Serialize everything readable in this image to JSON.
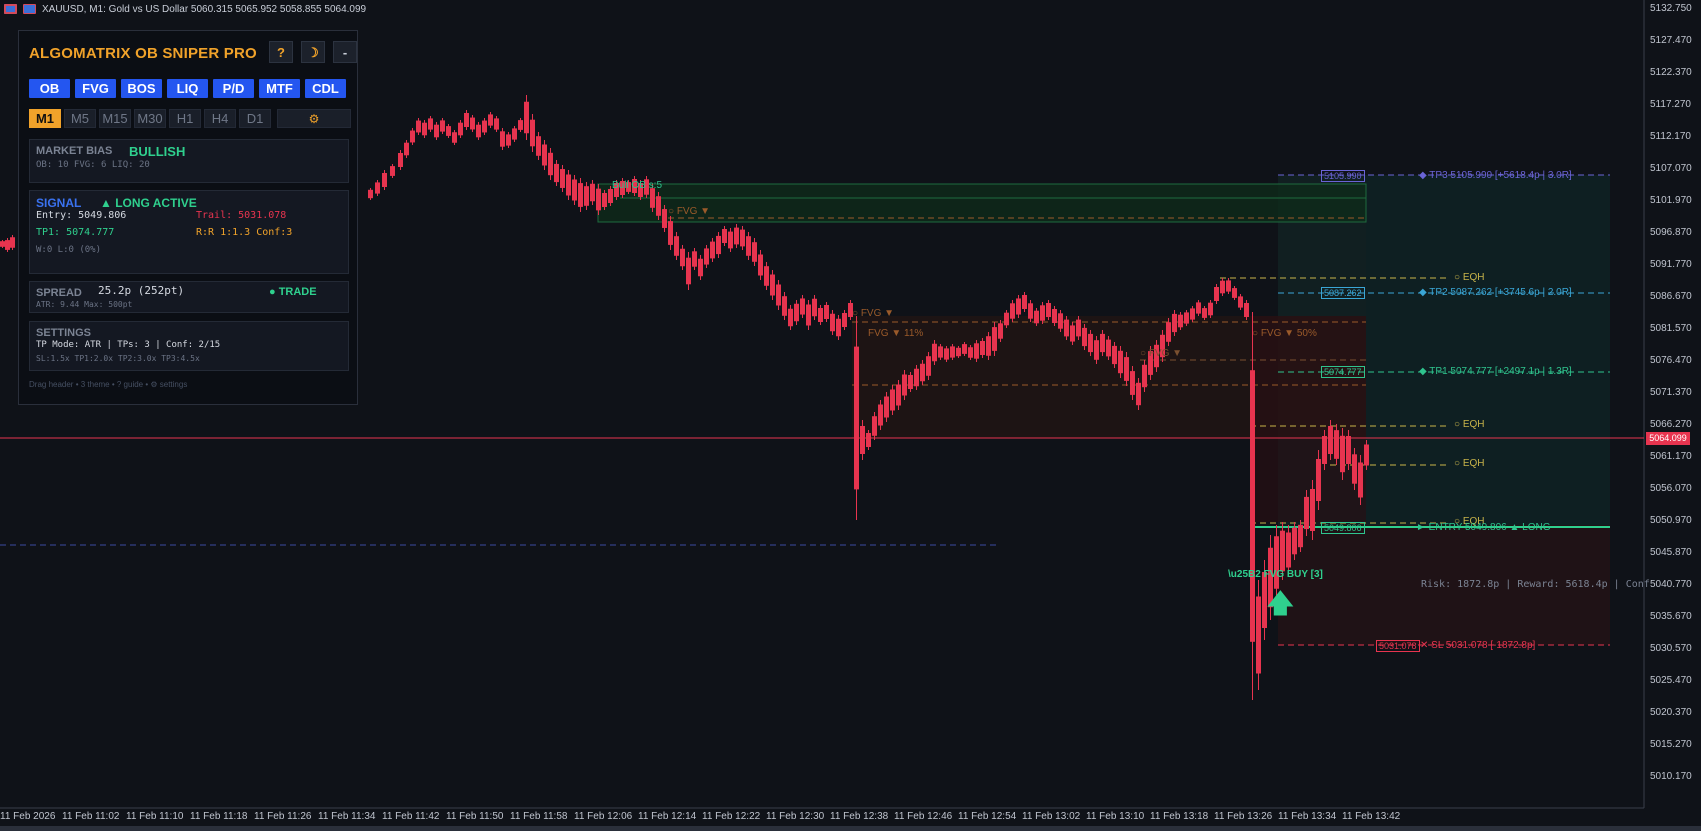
{
  "topbar": {
    "symbol_info": "XAUUSD, M1:  Gold vs US Dollar  5060.315 5065.952 5058.855 5064.099"
  },
  "panel": {
    "title": "ALGOMATRIX  OB SNIPER PRO",
    "help_label": "?",
    "theme_label": "☽",
    "minimize_label": "-",
    "feature_buttons": [
      "OB",
      "FVG",
      "BOS",
      "LIQ",
      "P/D",
      "MTF",
      "CDL"
    ],
    "timeframes": [
      "M1",
      "M5",
      "M15",
      "M30",
      "H1",
      "H4",
      "D1"
    ],
    "active_timeframe": "M1",
    "settings_gear": "⚙",
    "market_bias": {
      "label": "MARKET BIAS",
      "value": "BULLISH",
      "stats": "OB: 10  FVG: 6  LIQ: 20"
    },
    "signal": {
      "label": "SIGNAL",
      "status": "▲ LONG ACTIVE",
      "entry": "Entry: 5049.806",
      "trail": "Trail: 5031.078",
      "tp1": "TP1: 5074.777",
      "rr": "R:R 1:1.3   Conf:3",
      "winloss": "W:0 L:0 (0%)"
    },
    "spread": {
      "label": "SPREAD",
      "value": "25.2p (252pt)",
      "status": "● TRADE",
      "atr": "ATR: 9.44  Max: 500pt"
    },
    "settings": {
      "label": "SETTINGS",
      "line1": "TP Mode: ATR  |  TPs: 3  |  Conf: 2/15",
      "line2": "SL:1.5x  TP1:2.0x  TP2:3.0x  TP3:4.5x"
    },
    "footer_hint": "Drag header • 3 theme • ? guide • ⚙ settings"
  },
  "price_axis": [
    "5132.750",
    "5127.470",
    "5122.370",
    "5117.270",
    "5112.170",
    "5107.070",
    "5101.970",
    "5096.870",
    "5091.770",
    "5086.670",
    "5081.570",
    "5076.470",
    "5071.370",
    "5066.270",
    "5061.170",
    "5056.070",
    "5050.970",
    "5045.870",
    "5040.770",
    "5035.670",
    "5030.570",
    "5025.470",
    "5020.370",
    "5015.270",
    "5010.170"
  ],
  "current_price_tag": "5064.099",
  "time_axis": [
    "11 Feb 2026",
    "11 Feb 11:02",
    "11 Feb 11:10",
    "11 Feb 11:18",
    "11 Feb 11:26",
    "11 Feb 11:34",
    "11 Feb 11:42",
    "11 Feb 11:50",
    "11 Feb 11:58",
    "11 Feb 12:06",
    "11 Feb 12:14",
    "11 Feb 12:22",
    "11 Feb 12:30",
    "11 Feb 12:38",
    "11 Feb 12:46",
    "11 Feb 12:54",
    "11 Feb 13:02",
    "11 Feb 13:10",
    "11 Feb 13:18",
    "11 Feb 13:26",
    "11 Feb 13:34",
    "11 Feb 13:42"
  ],
  "annotations": {
    "ob_label": "Bull OB  s:5",
    "fvg1": "○ FVG ▼",
    "fvg2": "○ FVG ▼",
    "fvg3": "FVG ▼  11%",
    "fvg4": "○ FVG ▼",
    "fvg5": "○ FVG ▼  50%",
    "eqh1": "○ EQH",
    "eqh2": "○ EQH",
    "eqh3": "○ EQH",
    "eqh4": "○ EQH",
    "tp3": "◆ TP3 5105.990  [+5618.4p | 3.0R]",
    "tp2": "◆ TP2 5087.262  [+3745.6p | 2.0R]",
    "tp1": "◆ TP1 5074.777  [+2497.1p | 1.3R]",
    "tp3_box": "5105.990",
    "tp2_box": "5087.262",
    "tp1_box": "5074.777",
    "entry_box": "5049.806",
    "entry": "► ENTRY 5049.806  ▲ LONG",
    "sl_box": "5031.078",
    "sl": "✕ SL 5031.078  [-1872.8p]",
    "risk_reward": "Risk: 1872.8p | Reward: 5618.4p | Conf",
    "fvg_buy": "\\u25B2 FVG BUY [3]"
  },
  "colors": {
    "accent": "#f0a22a",
    "feature_button": "#2456f0",
    "bear_candle": "#e7344f",
    "bull_text": "#2fd08e",
    "tp3": "#6a64d6",
    "tp2": "#3aa6d6",
    "tp1": "#2fc48e",
    "sl": "#e7344f"
  }
}
